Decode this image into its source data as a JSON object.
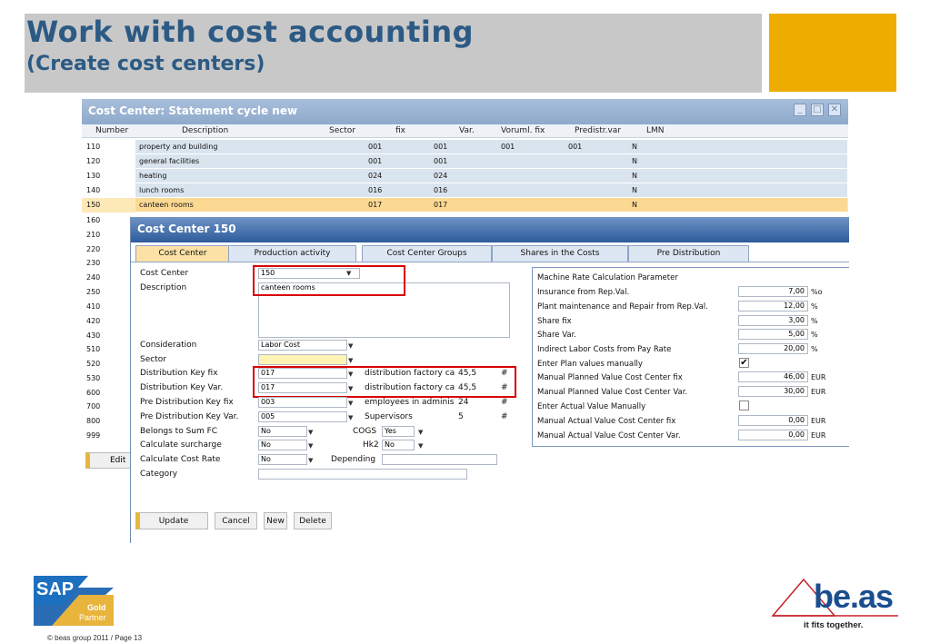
{
  "header": {
    "title": "Work with cost accounting",
    "subtitle": "(Create cost centers)"
  },
  "outer_window": {
    "title": "Cost Center: Statement cycle new",
    "columns": [
      "Number",
      "Description",
      "Sector",
      "fix",
      "Var.",
      "Voruml. fix",
      "Predistr.var",
      "LMN"
    ],
    "rows": [
      {
        "number": "110",
        "description": "property and building",
        "fix": "001",
        "var": "001",
        "voruml": "001",
        "predistr": "001",
        "lmn": "N"
      },
      {
        "number": "120",
        "description": "general facilities",
        "fix": "001",
        "var": "001",
        "voruml": "",
        "predistr": "",
        "lmn": "N"
      },
      {
        "number": "130",
        "description": "heating",
        "fix": "024",
        "var": "024",
        "voruml": "",
        "predistr": "",
        "lmn": "N"
      },
      {
        "number": "140",
        "description": "lunch rooms",
        "fix": "016",
        "var": "016",
        "voruml": "",
        "predistr": "",
        "lmn": "N"
      },
      {
        "number": "150",
        "description": "canteen rooms",
        "fix": "017",
        "var": "017",
        "voruml": "",
        "predistr": "",
        "lmn": "N"
      }
    ],
    "extra_numbers": [
      "160",
      "210",
      "220",
      "230",
      "240",
      "250",
      "410",
      "420",
      "430",
      "510",
      "520",
      "530",
      "600",
      "700",
      "800",
      "999"
    ],
    "edit_label": "Edit"
  },
  "inner_window": {
    "title": "Cost Center 150",
    "tabs": [
      "Cost Center",
      "Production activity",
      "Cost Center Groups",
      "Shares in the Costs",
      "Pre Distribution"
    ],
    "fields": {
      "cost_center_label": "Cost Center",
      "cost_center_value": "150",
      "description_label": "Description",
      "description_value": "canteen rooms",
      "consideration_label": "Consideration",
      "consideration_value": "Labor Cost",
      "sector_label": "Sector",
      "sector_value": "",
      "dist_fix_label": "Distribution Key fix",
      "dist_fix_value": "017",
      "dist_fix_desc": "distribution factory ca",
      "dist_fix_num": "45,5",
      "dist_fix_hash": "#",
      "dist_var_label": "Distribution Key Var.",
      "dist_var_value": "017",
      "dist_var_desc": "distribution factory ca",
      "dist_var_num": "45,5",
      "dist_var_hash": "#",
      "pre_fix_label": "Pre Distribution Key fix",
      "pre_fix_value": "003",
      "pre_fix_desc": "employees in adminis",
      "pre_fix_num": "24",
      "pre_fix_hash": "#",
      "pre_var_label": "Pre Distribution Key Var.",
      "pre_var_value": "005",
      "pre_var_desc": "Supervisors",
      "pre_var_num": "5",
      "pre_var_hash": "#",
      "sum_fc_label": "Belongs to Sum FC",
      "sum_fc_value": "No",
      "cogs_label": "COGS",
      "cogs_value": "Yes",
      "surcharge_label": "Calculate surcharge",
      "surcharge_value": "No",
      "hk2_label": "Hk2",
      "hk2_value": "No",
      "cost_rate_label": "Calculate Cost Rate",
      "cost_rate_value": "No",
      "depending_label": "Depending",
      "depending_value": "",
      "category_label": "Category",
      "category_value": ""
    },
    "right_panel": {
      "title": "Machine Rate Calculation Parameter",
      "rows": [
        {
          "label": "Insurance from Rep.Val.",
          "value": "7,00",
          "unit": "%o"
        },
        {
          "label": "Plant maintenance and Repair from Rep.Val.",
          "value": "12,00",
          "unit": "%"
        },
        {
          "label": "Share fix",
          "value": "3,00",
          "unit": "%"
        },
        {
          "label": "Share Var.",
          "value": "5,00",
          "unit": "%"
        },
        {
          "label": "Indirect Labor Costs from Pay Rate",
          "value": "20,00",
          "unit": "%"
        },
        {
          "label": "Enter Plan values manually",
          "check": "✔"
        },
        {
          "label": "Manual Planned Value Cost Center fix",
          "value": "46,00",
          "unit": "EUR"
        },
        {
          "label": "Manual Planned Value Cost Center Var.",
          "value": "30,00",
          "unit": "EUR"
        },
        {
          "label": "Enter Actual Value Manually",
          "check": ""
        },
        {
          "label": "Manual Actual Value Cost Center fix",
          "value": "0,00",
          "unit": "EUR"
        },
        {
          "label": "Manual Actual Value Cost Center Var.",
          "value": "0,00",
          "unit": "EUR"
        }
      ]
    },
    "buttons": {
      "update": "Update",
      "cancel": "Cancel",
      "new": "New",
      "delete": "Delete"
    }
  },
  "footer": {
    "sap": "SAP",
    "gold": "Gold",
    "partner": "Partner",
    "copyright": "© beas group 2011 / Page 13",
    "beas": "be.as",
    "slogan": "it fits together."
  },
  "colors": {
    "title": "#2c5a84",
    "accent": "#eeab00",
    "selected_row": "#fbd993",
    "highlight": "#d80000"
  }
}
